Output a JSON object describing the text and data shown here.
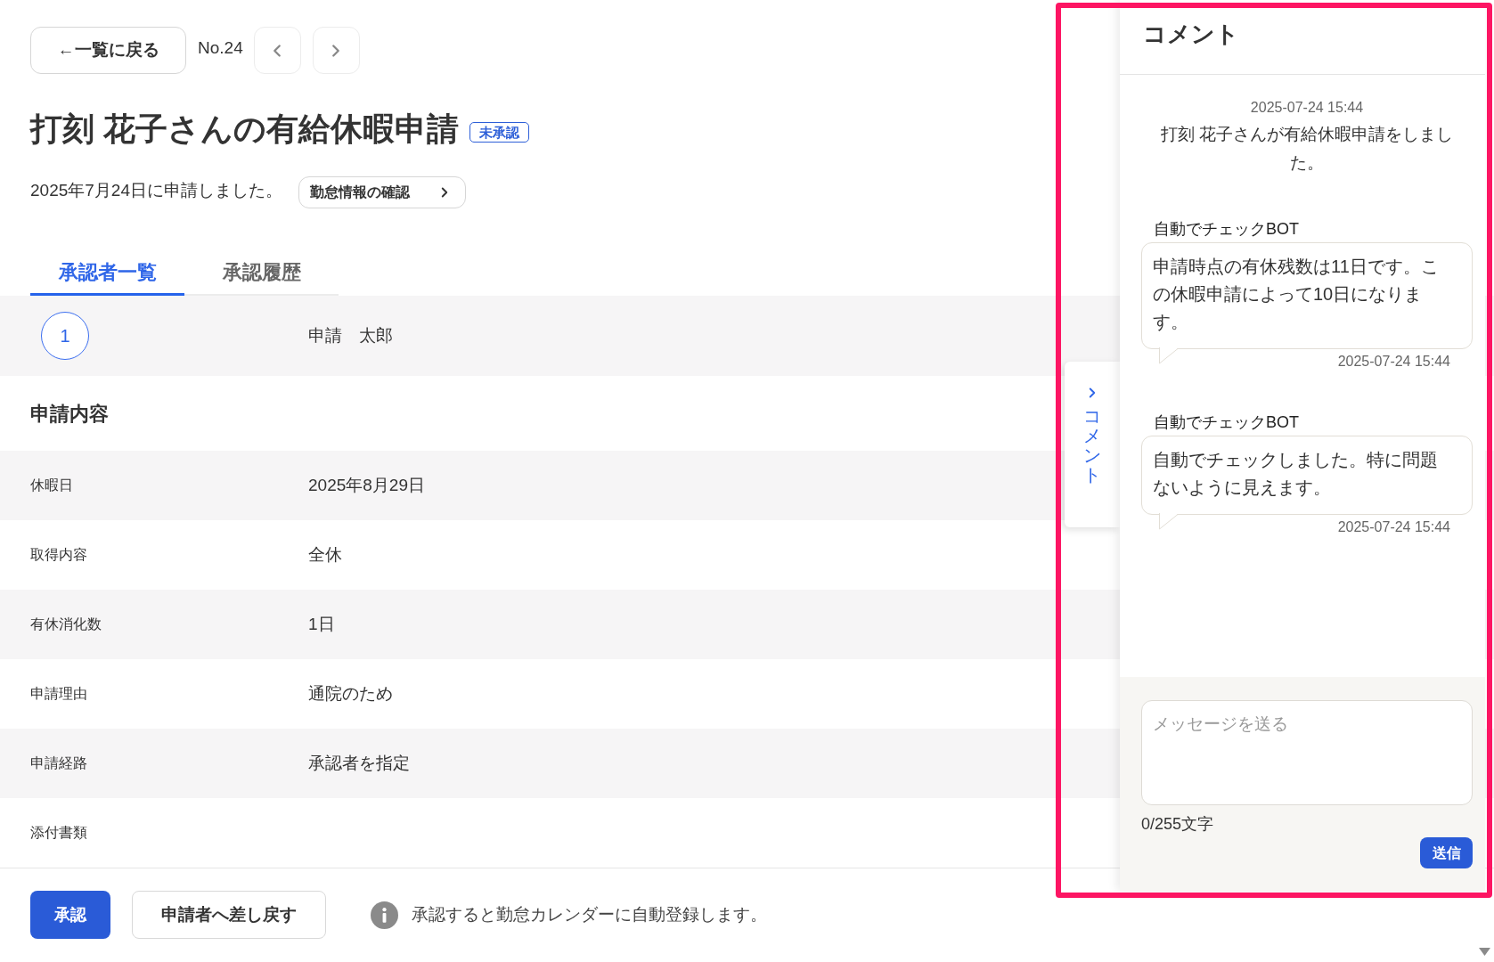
{
  "nav": {
    "back_button": "←一覧に戻る",
    "number": "No.24"
  },
  "header": {
    "title": "打刻 花子さんの有給休暇申請",
    "status_badge": "未承認",
    "submitted_text": "2025年7月24日に申請しました。",
    "attendance_button": "勤怠情報の確認"
  },
  "tabs": [
    {
      "label": "承認者一覧",
      "selected": true
    },
    {
      "label": "承認履歴",
      "selected": false
    }
  ],
  "approvers": [
    {
      "step": "1",
      "name": "申請　太郎"
    }
  ],
  "details": {
    "heading": "申請内容",
    "rows": [
      {
        "label": "休暇日",
        "value": "2025年8月29日"
      },
      {
        "label": "取得内容",
        "value": "全休"
      },
      {
        "label": "有休消化数",
        "value": "1日"
      },
      {
        "label": "申請理由",
        "value": "通院のため"
      },
      {
        "label": "申請経路",
        "value": "承認者を指定"
      },
      {
        "label": "添付書類"
      }
    ]
  },
  "actions": {
    "approve_button": "承認",
    "return_button": "申請者へ差し戻す",
    "notice": "承認すると勤怠カレンダーに自動登録します。"
  },
  "comment_panel": {
    "toggle_label": "コメント",
    "title": "コメント",
    "messages": [
      {
        "kind": "system",
        "time": "2025-07-24 15:44",
        "text": "打刻 花子さんが有給休暇申請をしました。"
      },
      {
        "kind": "bubble",
        "sender": "自動でチェックBOT",
        "text": "申請時点の有休残数は11日です。この休暇申請によって10日になります。",
        "time": "2025-07-24 15:44"
      },
      {
        "kind": "bubble",
        "sender": "自動でチェックBOT",
        "text": "自動でチェックしました。特に問題ないように見えます。",
        "time": "2025-07-24 15:44"
      }
    ],
    "input": {
      "placeholder": "メッセージを送る"
    },
    "counter": "0/255文字",
    "send_button": "送信"
  }
}
